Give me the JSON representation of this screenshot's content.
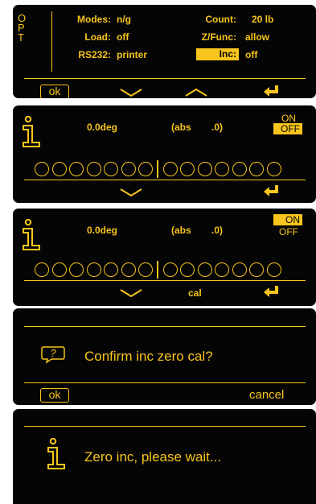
{
  "screen1": {
    "opt": [
      "O",
      "P",
      "T"
    ],
    "fields": [
      {
        "label": "Modes:",
        "value": "n/g"
      },
      {
        "label": "Load:",
        "value": "off"
      },
      {
        "label": "RS232:",
        "value": "printer"
      }
    ],
    "fields_right": [
      {
        "label": "Count:",
        "value": "20 lb"
      },
      {
        "label": "Z/Func:",
        "value": "allow"
      },
      {
        "label": "Inc:",
        "value": "off"
      }
    ],
    "ok_label": "ok",
    "icons": [
      "chevron-down-icon",
      "chevron-up-icon",
      "enter-icon"
    ]
  },
  "screen2": {
    "angle": "0.0deg",
    "abs": "(abs",
    "abs_val": ".0)",
    "on_label": "ON",
    "off_label": "OFF",
    "selected": "OFF",
    "circle_count_left": 7,
    "circle_count_right": 7,
    "icons": [
      "info-icon",
      "chevron-down-icon",
      "enter-icon"
    ]
  },
  "screen3": {
    "angle": "0.0deg",
    "abs": "(abs",
    "abs_val": ".0)",
    "on_label": "ON",
    "off_label": "OFF",
    "selected": "ON",
    "cal_label": "cal",
    "icons": [
      "info-icon",
      "chevron-down-icon",
      "enter-icon"
    ]
  },
  "screen4": {
    "message": "Confirm inc zero cal?",
    "ok_label": "ok",
    "cancel_label": "cancel",
    "icons": [
      "question-bubble-icon"
    ]
  },
  "screen5": {
    "message": "Zero inc, please wait...",
    "icons": [
      "info-icon"
    ]
  },
  "colors": {
    "accent": "#f7c51c",
    "background": "#050505"
  }
}
